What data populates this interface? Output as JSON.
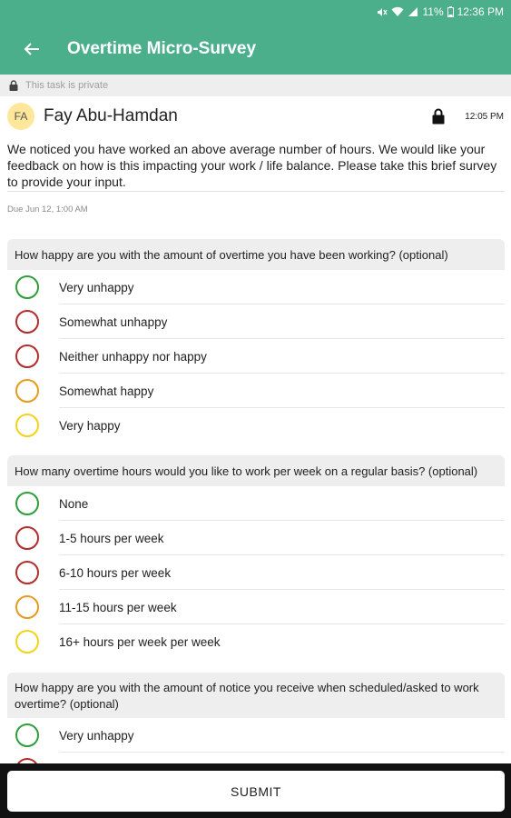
{
  "status_bar": {
    "battery": "11%",
    "time": "12:36 PM",
    "icons": [
      "mute-icon",
      "wifi-icon",
      "signal-icon",
      "battery-icon"
    ]
  },
  "app_bar": {
    "title": "Overtime Micro-Survey",
    "back_icon": "back-arrow-icon",
    "color": "#4caf8b"
  },
  "private_banner": {
    "text": "This task is private",
    "icon": "lock-icon"
  },
  "header": {
    "avatar_initials": "FA",
    "author": "Fay Abu-Hamdan",
    "time": "12:05 PM",
    "lock_icon": "lock-icon"
  },
  "description": "We noticed you have worked an above average number of hours. We would like your feedback on how is this impacting your work / life balance. Please take this brief survey to provide your input.",
  "due": "Due Jun 12, 1:00 AM",
  "colors": {
    "green": "#2e9e3a",
    "red": "#b32c2c",
    "orange": "#e89a1c",
    "yellow": "#f2d21a"
  },
  "questions": [
    {
      "text": "How happy are you with the amount of overtime you have been working? (optional)",
      "options": [
        {
          "label": "Very unhappy",
          "color": "#2e9e3a"
        },
        {
          "label": "Somewhat unhappy",
          "color": "#b32c2c"
        },
        {
          "label": "Neither unhappy nor happy",
          "color": "#b32c2c"
        },
        {
          "label": "Somewhat happy",
          "color": "#e89a1c"
        },
        {
          "label": "Very happy",
          "color": "#f2d21a"
        }
      ]
    },
    {
      "text": "How many overtime hours would you like to work per week on a regular basis? (optional)",
      "options": [
        {
          "label": "None",
          "color": "#2e9e3a"
        },
        {
          "label": "1-5 hours per week",
          "color": "#b32c2c"
        },
        {
          "label": "6-10 hours per week",
          "color": "#b32c2c"
        },
        {
          "label": "11-15 hours per week",
          "color": "#e89a1c"
        },
        {
          "label": "16+ hours per week per week",
          "color": "#f2d21a"
        }
      ]
    },
    {
      "text": "How happy are you with the amount of notice you receive when scheduled/asked to work overtime? (optional)",
      "options": [
        {
          "label": "Very unhappy",
          "color": "#2e9e3a"
        },
        {
          "label": "",
          "color": "#b32c2c"
        }
      ]
    }
  ],
  "submit_label": "SUBMIT"
}
